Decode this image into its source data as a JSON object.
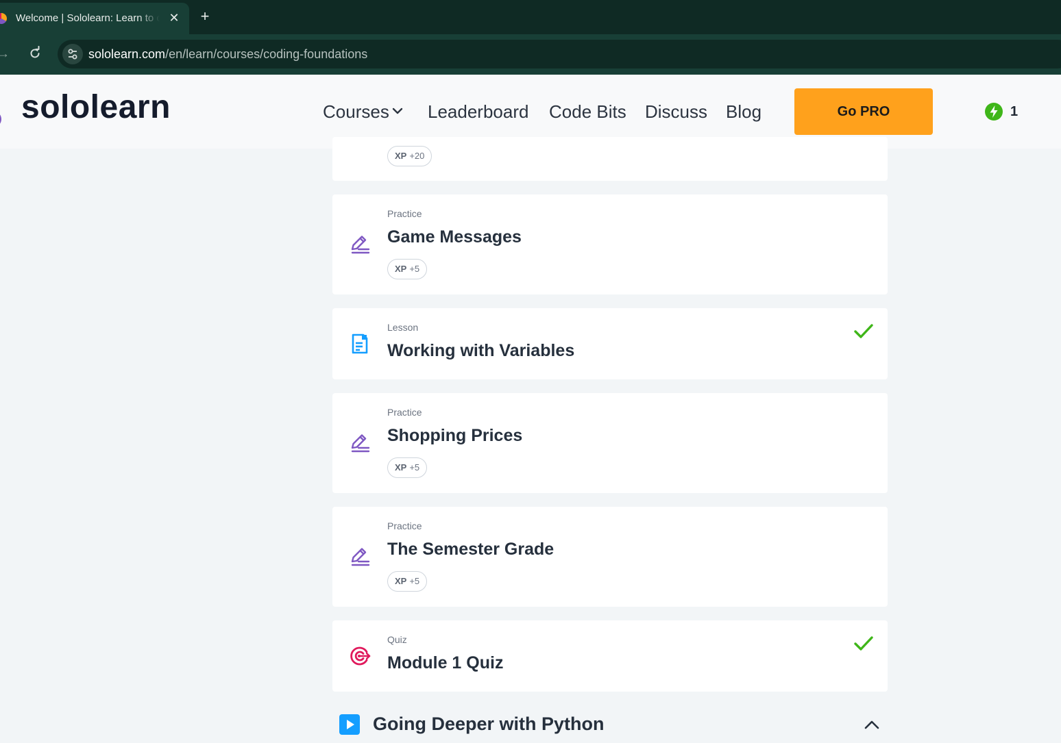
{
  "browser": {
    "tab_title": "Welcome | Sololearn: Learn to code for FREE!",
    "url_host": "sololearn.com",
    "url_path": "/en/learn/courses/coding-foundations"
  },
  "header": {
    "logo": "sololearn",
    "nav": [
      "Courses",
      "Leaderboard",
      "Code Bits",
      "Discuss",
      "Blog"
    ],
    "go_pro": "Go PRO",
    "streak_count": "1"
  },
  "items": [
    {
      "xp_label": "XP",
      "xp_value": "+20"
    },
    {
      "type": "Practice",
      "title": "Game Messages",
      "xp_label": "XP",
      "xp_value": "+5",
      "icon": "practice-pencil-icon"
    },
    {
      "type": "Lesson",
      "title": "Working with Variables",
      "completed": true,
      "icon": "lesson-document-icon"
    },
    {
      "type": "Practice",
      "title": "Shopping Prices",
      "xp_label": "XP",
      "xp_value": "+5",
      "icon": "practice-pencil-icon"
    },
    {
      "type": "Practice",
      "title": "The Semester Grade",
      "xp_label": "XP",
      "xp_value": "+5",
      "icon": "practice-pencil-icon"
    },
    {
      "type": "Quiz",
      "title": "Module 1 Quiz",
      "completed": true,
      "icon": "quiz-target-icon"
    }
  ],
  "next_section": {
    "title": "Going Deeper with Python",
    "expanded": true
  },
  "colors": {
    "brand_orange": "#ffa11c",
    "practice_purple": "#7e57c2",
    "lesson_blue": "#149eff",
    "quiz_red": "#e0195c",
    "check_green": "#3fb619"
  }
}
